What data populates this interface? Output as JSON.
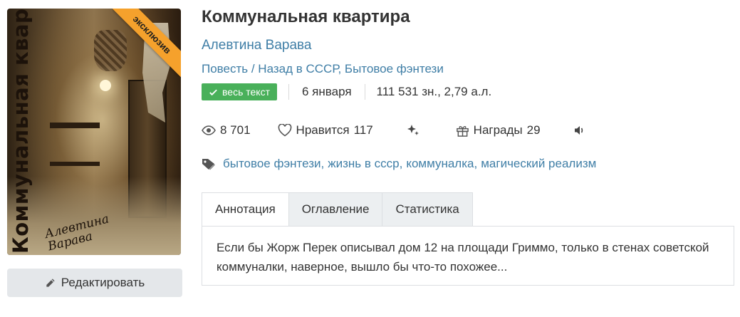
{
  "cover": {
    "title_text": "Коммунальная квартира",
    "author_text": "Алевтина Варава",
    "ribbon": "эксклюзив",
    "ribbon_color": "#f5a12c"
  },
  "edit_button": {
    "label": "Редактировать",
    "icon": "pencil-icon"
  },
  "book": {
    "title": "Коммунальная квартира",
    "author": "Алевтина Варава",
    "form": "Повесть",
    "genre_separator": " / ",
    "genre_primary": "Назад в СССР",
    "genre_secondary": "Бытовое фэнтези"
  },
  "meta": {
    "status_badge": "весь текст",
    "status_color": "#49b05a",
    "date": "6 января",
    "size": "111 531 зн., 2,79 а.л."
  },
  "stats": {
    "views": "8 701",
    "likes_label": "Нравится",
    "likes": "117",
    "rewards_label": "Награды",
    "rewards": "29",
    "icons": [
      "eye-icon",
      "heart-icon",
      "sparkles-icon",
      "gift-icon",
      "speaker-icon"
    ]
  },
  "tags": [
    "бытовое фэнтези",
    "жизнь в ссср",
    "коммуналка",
    "магический реализм"
  ],
  "tabs": [
    {
      "label": "Аннотация",
      "active": true
    },
    {
      "label": "Оглавление",
      "active": false
    },
    {
      "label": "Статистика",
      "active": false
    }
  ],
  "annotation": "Если бы Жорж Перек описывал дом 12 на площади Гриммо, только в стенах советской коммуналки, наверное, вышло бы что-то похожее...",
  "colors": {
    "link": "#3f7ea6",
    "text": "#333333",
    "tab_bg": "#eceff1"
  }
}
